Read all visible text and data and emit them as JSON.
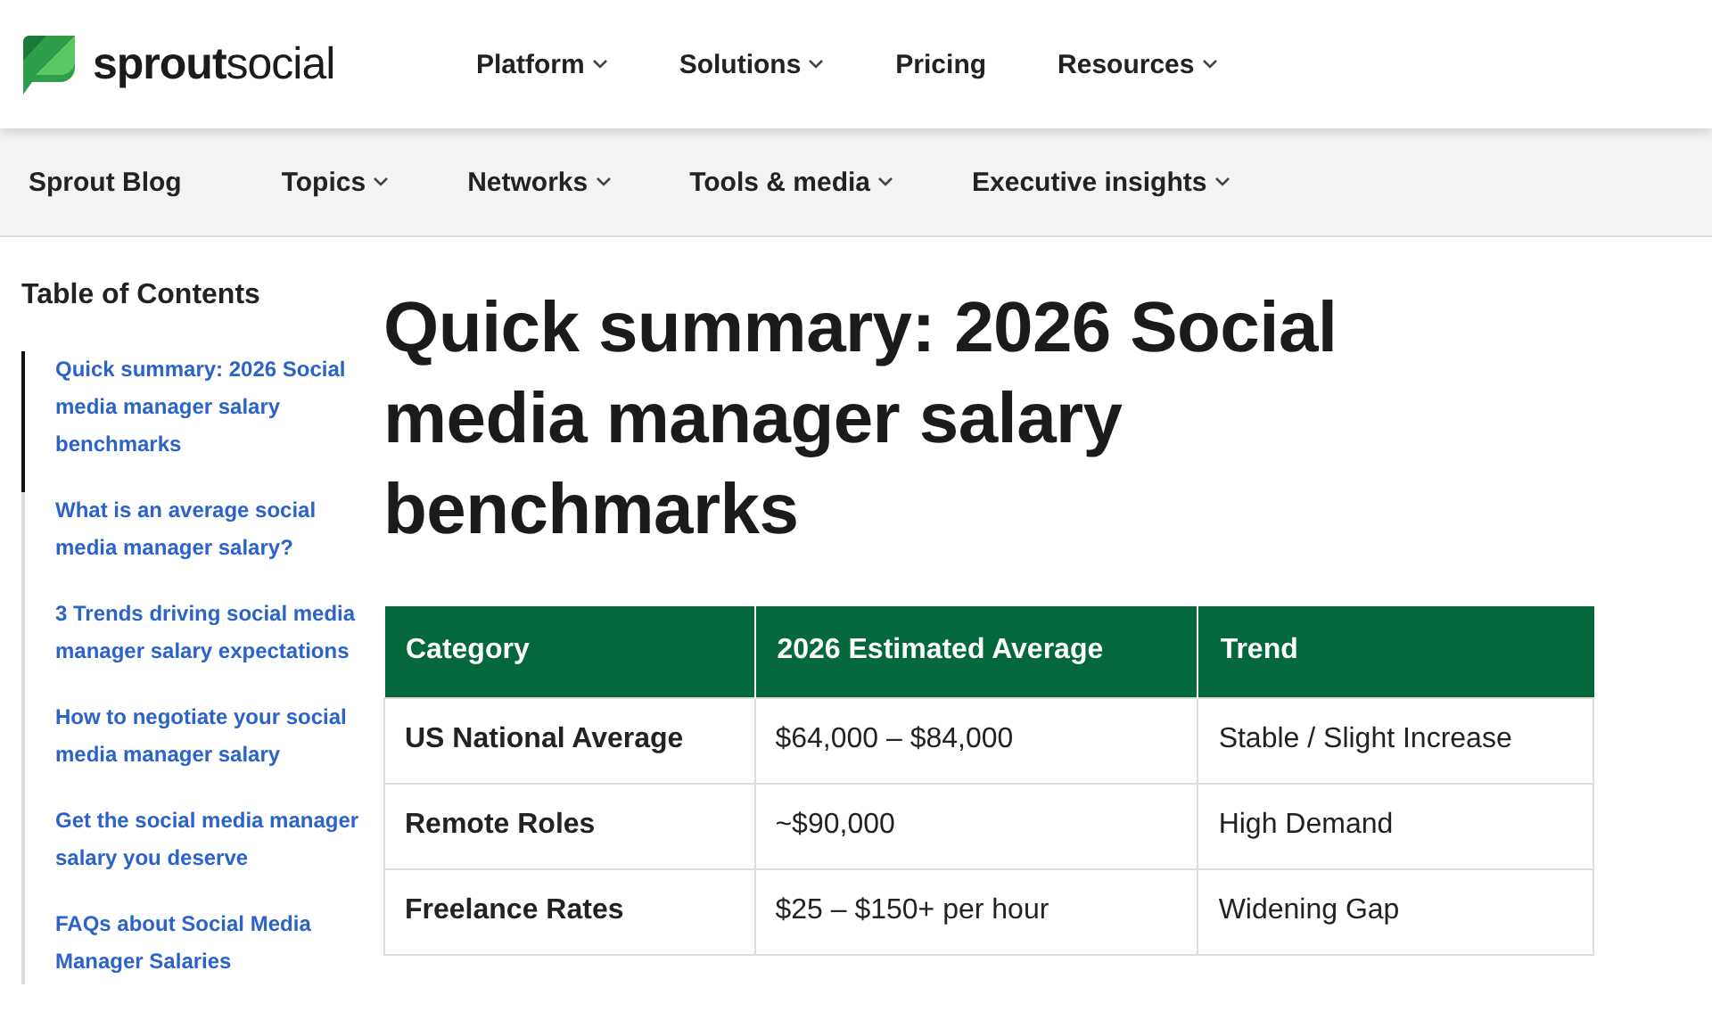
{
  "header": {
    "logo": "**sprout**social",
    "nav": [
      {
        "label": "Platform",
        "dropdown": true
      },
      {
        "label": "Solutions",
        "dropdown": true
      },
      {
        "label": "Pricing",
        "dropdown": false
      },
      {
        "label": "Resources",
        "dropdown": true
      }
    ]
  },
  "subnav": {
    "home": "Sprout Blog",
    "items": [
      {
        "label": "Topics",
        "dropdown": true
      },
      {
        "label": "Networks",
        "dropdown": true
      },
      {
        "label": "Tools & media",
        "dropdown": true
      },
      {
        "label": "Executive insights",
        "dropdown": true
      }
    ]
  },
  "toc": {
    "title": "Table of Contents",
    "items": [
      {
        "label": "Quick summary: 2026 Social media manager salary benchmarks",
        "selected": true
      },
      {
        "label": "What is an average social media manager salary?",
        "selected": false
      },
      {
        "label": "3 Trends driving social media manager salary expectations",
        "selected": false
      },
      {
        "label": "How to negotiate your social media manager salary",
        "selected": false
      },
      {
        "label": "Get the social media manager salary you deserve",
        "selected": false
      },
      {
        "label": "FAQs about Social Media Manager Salaries",
        "selected": false
      }
    ]
  },
  "article": {
    "heading": "Quick summary: 2026 Social media manager salary benchmarks",
    "table": {
      "columns": [
        "Category",
        "2026 Estimated Average",
        "Trend"
      ],
      "rows": [
        [
          "US National Average",
          "$64,000 – $84,000",
          "Stable / Slight Increase"
        ],
        [
          "Remote Roles",
          "~$90,000",
          "High Demand"
        ],
        [
          "Freelance Rates",
          "$25 – $150+ per hour",
          "Widening Gap"
        ]
      ]
    }
  }
}
